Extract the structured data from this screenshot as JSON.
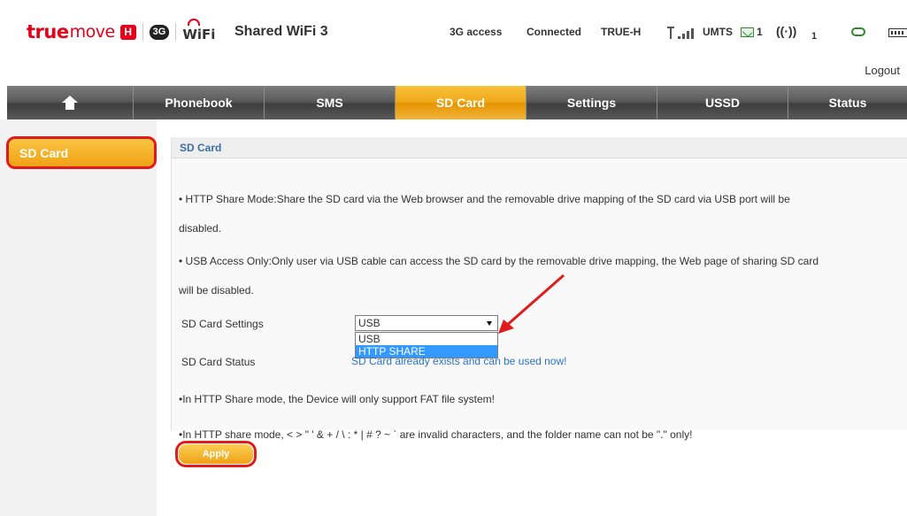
{
  "header": {
    "brand_true": "true",
    "brand_move": "move",
    "brand_h": "H",
    "brand_3g": "3G",
    "brand_wifi": "WiFi",
    "device_name": "Shared WiFi 3",
    "access_type": "3G access",
    "connection_status": "Connected",
    "operator": "TRUE-H",
    "network_mode": "UMTS",
    "sms_count": "1",
    "wifi_clients": "1",
    "logout": "Logout"
  },
  "nav": {
    "home": "home-icon",
    "items": [
      "Phonebook",
      "SMS",
      "SD Card",
      "Settings",
      "USSD",
      "Status"
    ],
    "active": "SD Card"
  },
  "sidebar": {
    "items": [
      "SD Card"
    ]
  },
  "panel": {
    "title": "SD Card",
    "para1_line1": "• HTTP Share Mode:Share the SD card via the Web browser and the removable drive mapping of the SD card via USB port will be",
    "para1_line2": "disabled.",
    "para2_line1": "• USB Access Only:Only user via USB cable can access the SD card by the removable drive mapping, the Web page of sharing SD card",
    "para2_line2": "will be disabled.",
    "settings_label": "SD Card Settings",
    "settings_value": "USB",
    "settings_options": [
      "USB",
      "HTTP SHARE"
    ],
    "status_label": "SD Card Status",
    "status_value": "SD Card already exists and can be used now!",
    "note1": "•In HTTP Share mode, the Device will only support FAT file system!",
    "note2": "•In HTTP share mode, < > \" ' & + / \\ : * | # ? ~ ` are invalid characters, and the folder name can not be \".\" only!"
  },
  "apply_label": "Apply",
  "colors": {
    "brand_red": "#e3001b",
    "active_orange": "#f0a819",
    "highlight_red": "#e01b1b",
    "link_blue": "#2b73c6",
    "selection_blue": "#3399ff"
  }
}
